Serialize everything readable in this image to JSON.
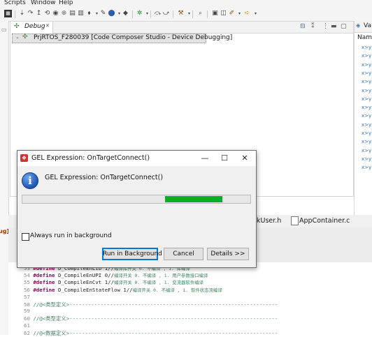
{
  "menubar": {
    "items": [
      "Scripts",
      "Window",
      "Help"
    ]
  },
  "debug_view": {
    "tab_label": "Debug",
    "tree_item": "PrjRTOS_F280039 [Code Composer Studio - Device Debugging]"
  },
  "variables_view": {
    "tab_label": "Va",
    "column_header": "Nam",
    "row_glyph": "x>y"
  },
  "left_panel": {
    "fragment": "ug]"
  },
  "editor_tabs": [
    {
      "label": "kUser.h"
    },
    {
      "label": "AppContainer.c"
    }
  ],
  "code_lines": [
    {
      "num": "53",
      "kw": "#define",
      "text": " D_CompileEnLib 1//",
      "comment": "编译库开关 0. 不编译 , 1. 库编译"
    },
    {
      "num": "54",
      "kw": "#define",
      "text": " D_CompileEnUPI 0//",
      "comment": "编译开关 0. 不编译 , 1. 用户参数接口编译"
    },
    {
      "num": "55",
      "kw": "#define",
      "text": " D_CompileEnCvt 1//",
      "comment": "编译开关 0. 不编译 , 1. 变流器软件编译"
    },
    {
      "num": "56",
      "kw": "#define",
      "text": " D_CompileEnStateFlow 1//",
      "comment": "编译开关 0. 不编译 , 1. 软件状态流编译"
    },
    {
      "num": "57",
      "kw": "",
      "text": "",
      "comment": ""
    },
    {
      "num": "58",
      "kw": "",
      "text": "//@<类型定义>-------------------------------------------------------------------",
      "comment": ""
    },
    {
      "num": "59",
      "kw": "",
      "text": "",
      "comment": ""
    },
    {
      "num": "60",
      "kw": "",
      "text": "//@<类型定义>-------------------------------------------------------------------",
      "comment": ""
    },
    {
      "num": "61",
      "kw": "",
      "text": "",
      "comment": ""
    },
    {
      "num": "62",
      "kw": "",
      "text": "//@<数据定义>-------------------------------------------------------------------",
      "comment": ""
    }
  ],
  "dialog": {
    "title": "GEL Expression: OnTargetConnect()",
    "message": "GEL Expression: OnTargetConnect()",
    "progress_fraction": 0.25,
    "progress_start_fraction": 0.625,
    "checkbox_label": "Always run in background",
    "checkbox_checked": false,
    "buttons": {
      "run_background": "Run in Background",
      "cancel": "Cancel",
      "details": "Details >>"
    },
    "window_controls": {
      "minimize": "—",
      "maximize": "☐",
      "close": "✕"
    }
  },
  "colors": {
    "progress": "#06b025",
    "default_button_border": "#0078d7",
    "info_icon": "#1f57b4",
    "dialog_icon": "#d9302f"
  }
}
